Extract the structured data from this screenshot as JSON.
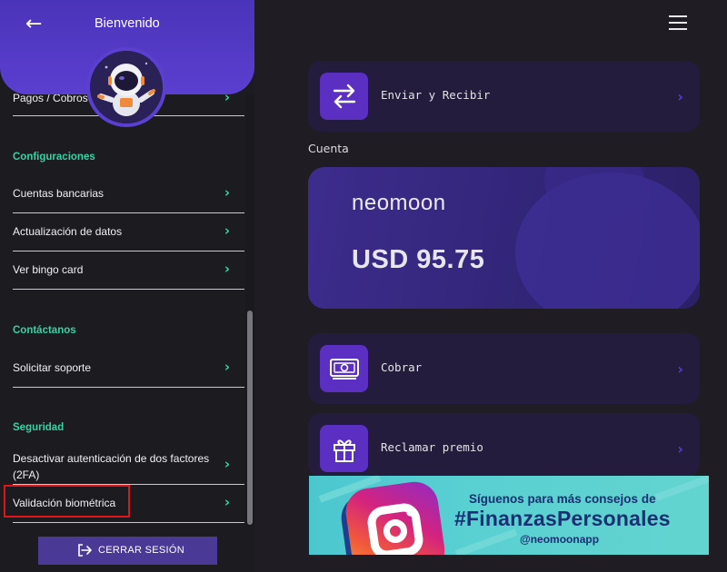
{
  "sidebar": {
    "title": "Bienvenido",
    "back_icon": "arrow-left-icon",
    "items_top": [
      {
        "label": "Pagos / Cobros"
      }
    ],
    "sections": [
      {
        "title": "Configuraciones",
        "items": [
          {
            "label": "Cuentas bancarias"
          },
          {
            "label": "Actualización de datos"
          },
          {
            "label": "Ver bingo card"
          }
        ]
      },
      {
        "title": "Contáctanos",
        "items": [
          {
            "label": "Solicitar soporte"
          }
        ]
      },
      {
        "title": "Seguridad",
        "items": [
          {
            "label": "Desactivar autenticación de dos factores (2FA)"
          },
          {
            "label": "Validación biométrica"
          }
        ]
      }
    ],
    "logout_label": "CERRAR SESIÓN",
    "chevron_color": "#37d6a0",
    "section_color": "#33d3a6"
  },
  "main": {
    "menu_icon": "hamburger-icon",
    "send_receive": {
      "label": "Enviar y Recibir",
      "icon": "swap-arrows-icon"
    },
    "account_section": "Cuenta",
    "balance": {
      "brand": "neomoon",
      "amount": "USD 95.75"
    },
    "collect": {
      "label": "Cobrar",
      "icon": "banknote-icon"
    },
    "prize": {
      "label": "Reclamar premio",
      "icon": "gift-icon"
    },
    "banner": {
      "line1": "Síguenos para más consejos de",
      "line2": "#FinanzasPersonales",
      "line3": "@neomoonapp",
      "icon": "instagram-icon"
    },
    "accent": "#5a2fc2"
  },
  "highlighted_item": "Validación biométrica"
}
